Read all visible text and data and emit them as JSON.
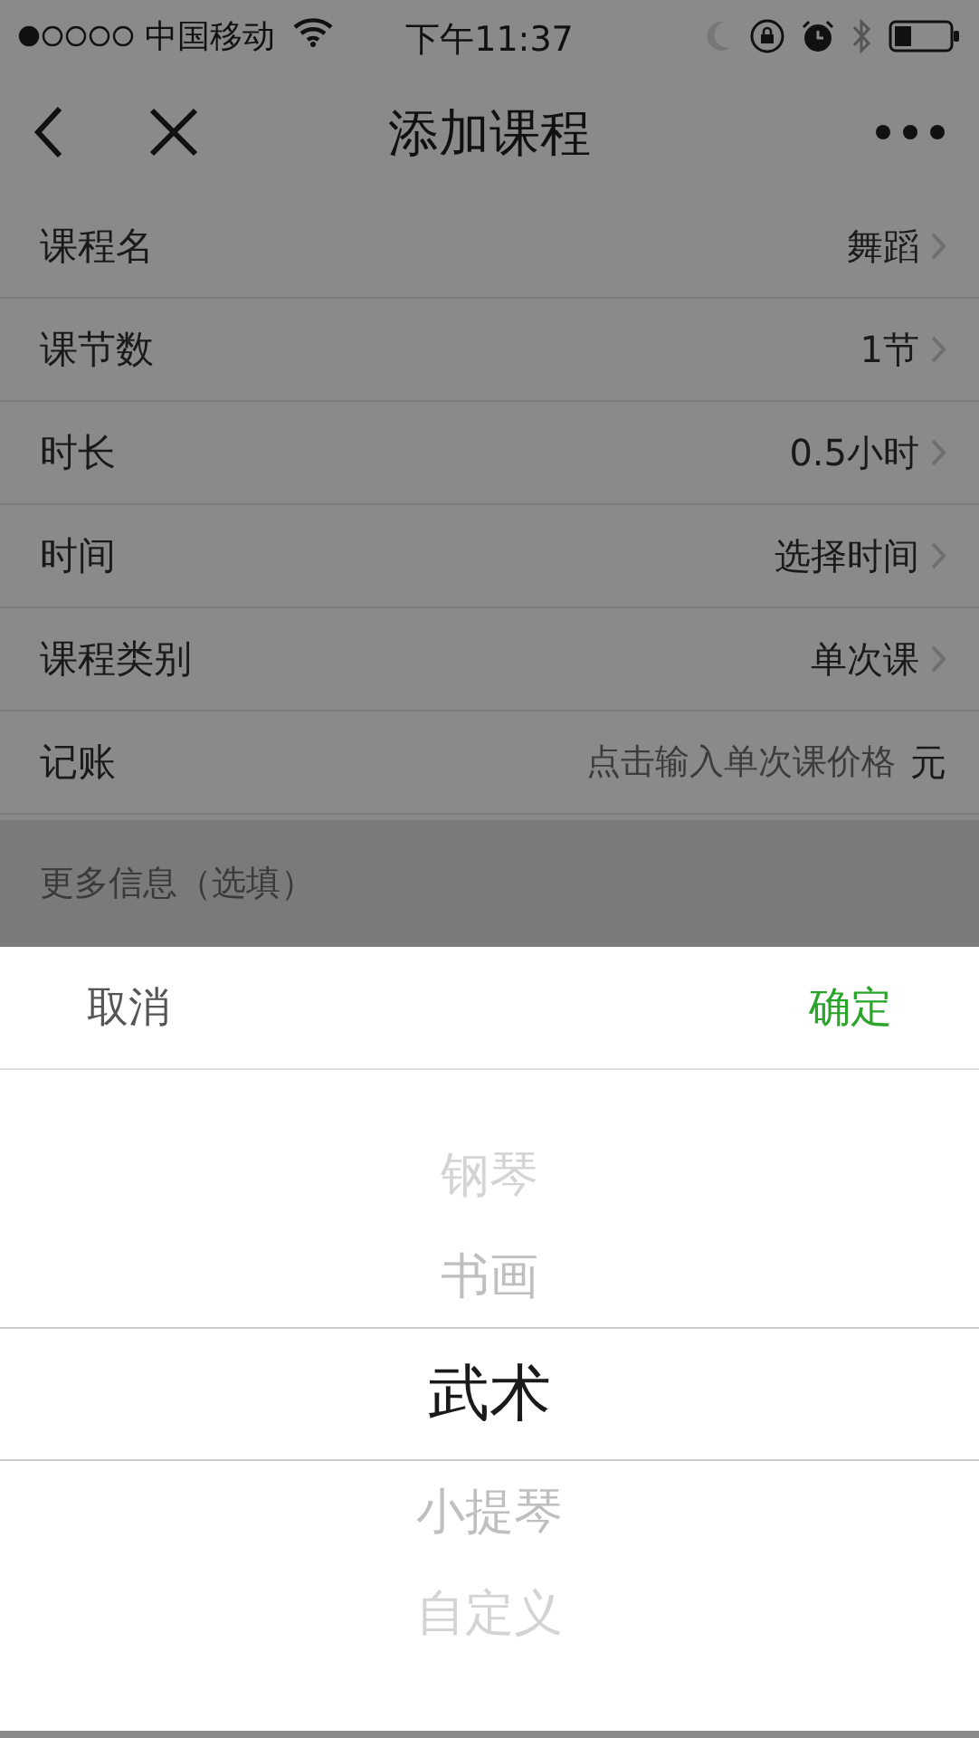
{
  "status_bar": {
    "carrier": "中国移动",
    "time": "下午11:37"
  },
  "nav": {
    "title": "添加课程"
  },
  "form_rows": [
    {
      "kind": "select",
      "label": "课程名",
      "value": "舞蹈"
    },
    {
      "kind": "select",
      "label": "课节数",
      "value": "1节"
    },
    {
      "kind": "select",
      "label": "时长",
      "value": "0.5小时"
    },
    {
      "kind": "select",
      "label": "时间",
      "value": "选择时间"
    },
    {
      "kind": "select",
      "label": "课程类别",
      "value": "单次课"
    },
    {
      "kind": "input",
      "label": "记账",
      "placeholder": "点击输入单次课价格",
      "unit": "元"
    }
  ],
  "section_header": "更多信息（选填）",
  "picker": {
    "cancel": "取消",
    "confirm": "确定",
    "items": [
      {
        "label": "钢琴",
        "selected": false
      },
      {
        "label": "书画",
        "selected": false
      },
      {
        "label": "武术",
        "selected": true
      },
      {
        "label": "小提琴",
        "selected": false
      },
      {
        "label": "自定义",
        "selected": false
      }
    ]
  }
}
